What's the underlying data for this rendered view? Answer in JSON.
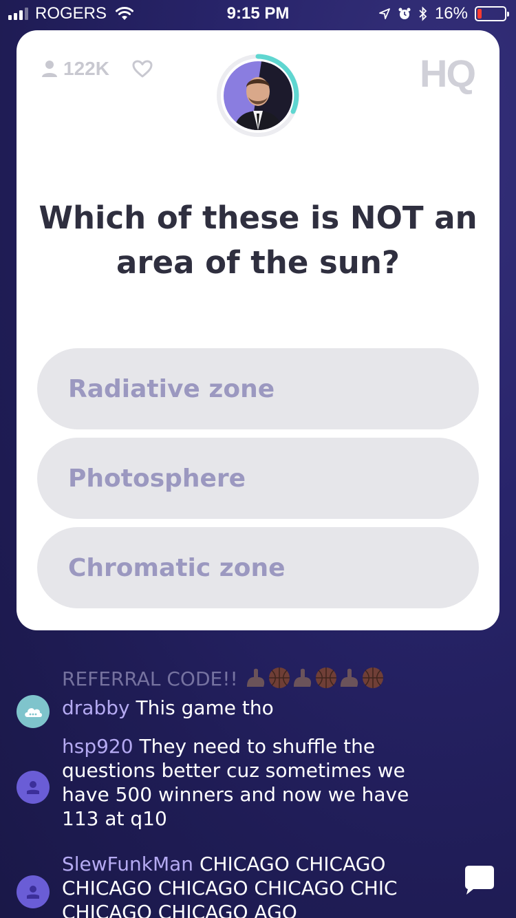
{
  "status_bar": {
    "carrier": "ROGERS",
    "time": "9:15 PM",
    "battery": "16%",
    "battery_level": 0.16,
    "icons": [
      "signal-icon",
      "wifi-icon",
      "location-icon",
      "alarm-icon",
      "bluetooth-icon",
      "battery-icon"
    ]
  },
  "game": {
    "viewer_count": "122K",
    "logo": "HQ",
    "question": "Which of these is NOT an area of the sun?",
    "answers": [
      "Radiative zone",
      "Photosphere",
      "Chromatic zone"
    ]
  },
  "chat": {
    "messages": [
      {
        "user": "",
        "text": "REFERRAL CODE!!"
      },
      {
        "user": "drabby",
        "text": "This game tho"
      },
      {
        "user": "hsp920",
        "text": "They need to shuffle the questions better cuz sometimes we have 500 winners and now we have 113 at q10"
      },
      {
        "user": "SlewFunkMan",
        "text": "CHICAGO CHICAGO CHICAGO CHICAGO CHICAGO CHIC CHICAGO CHICAGO AGO"
      }
    ]
  },
  "colors": {
    "background": "#241f62",
    "card": "#ffffff",
    "answer_bg": "#e6e6ea",
    "answer_text": "#9b98c0",
    "question_text": "#2f2f3f",
    "timer_ring": "#5fd6d0",
    "chat_username": "#b5aaf2"
  }
}
